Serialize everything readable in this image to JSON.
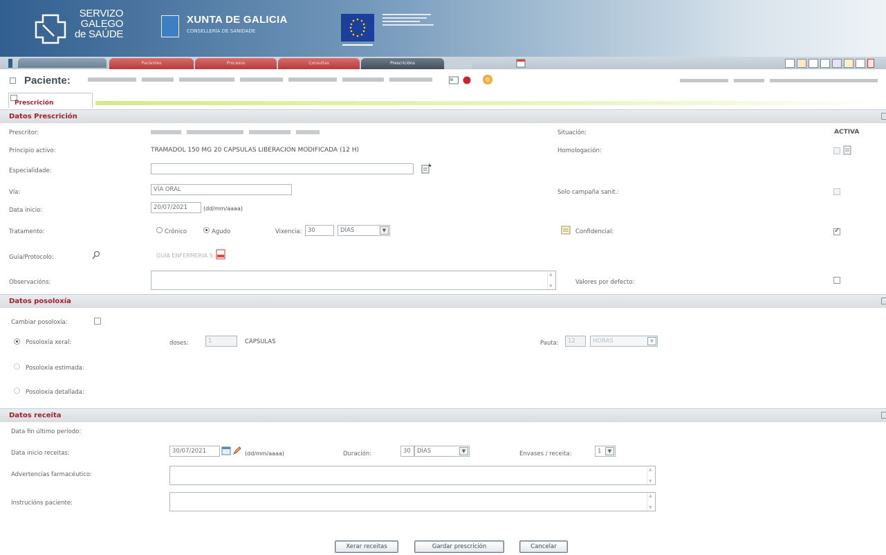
{
  "header": {
    "sgs_line1": "SERVIZO",
    "sgs_line2": "GALEGO",
    "sgs_line3": "de SAÚDE",
    "xunta_title": "XUNTA DE GALICIA",
    "xunta_sub": "CONSELLERÍA DE SANIDADE"
  },
  "tabs": [
    {
      "label": "Pacientes"
    },
    {
      "label": "Procesos"
    },
    {
      "label": "Consultas"
    },
    {
      "label": "Prescricións"
    }
  ],
  "patient": {
    "label": "Paciente:"
  },
  "subtab": {
    "label": "Prescrición"
  },
  "sections": {
    "prescripcion": "Datos Prescrición",
    "posoloxia": "Datos posoloxía",
    "receita": "Datos receita"
  },
  "prescripcion": {
    "prescriptor_label": "Prescritor:",
    "situacion_label": "Situación:",
    "situacion_value": "ACTIVA",
    "principio_label": "Principio activo:",
    "principio_value": "TRAMADOL 150 MG 20 CAPSULAS LIBERACION MODIFICADA (12 H)",
    "homologacion_label": "Homologación:",
    "especialidade_label": "Especialidade:",
    "via_label": "Vía:",
    "via_value": "VÍA ORAL",
    "solo_label": "Solo campaña sanit.:",
    "data_inicio_label": "Data inicio:",
    "data_inicio_value": "20/07/2021",
    "date_format": "(dd/mm/aaaa)",
    "tratamento_label": "Tratamento:",
    "cronico_label": "Crónico",
    "agudo_label": "Agudo",
    "vixencia_label": "Vixencia:",
    "vixencia_value": "30",
    "vixencia_unit": "DÍAS",
    "confidencial_label": "Confidencial:",
    "guia_label": "Guía/Protocolo:",
    "guia_value": "GUIA ENFERMERIA 5",
    "observacions_label": "Observacións:",
    "valores_label": "Valores por defecto:"
  },
  "posoloxia": {
    "cambiar_label": "Cambiar posoloxía:",
    "xeral_label": "Posoloxía xeral:",
    "doses_label": "doses:",
    "doses_value": "1",
    "doses_unit": "CÁPSULAS",
    "pauta_label": "Pauta:",
    "pauta_value": "12",
    "pauta_unit": "HORAS",
    "estimada_label": "Posoloxía estimada:",
    "detallada_label": "Posoloxía detallada:"
  },
  "receita": {
    "data_fin_label": "Data fin último período:",
    "data_inicio_label": "Data inicio receitas:",
    "data_inicio_value": "30/07/2021",
    "date_format": "(dd/mm/aaaa)",
    "duracion_label": "Duración:",
    "duracion_value": "30",
    "duracion_unit": "DÍAS",
    "envases_label": "Envases / receita:",
    "envases_value": "1",
    "advertencias_label": "Advertencias farmacéutico:",
    "instrucions_label": "Instrucións paciente:"
  },
  "buttons": {
    "xerar": "Xerar receitas",
    "gardar": "Gardar prescrición",
    "cancelar": "Cancelar"
  },
  "colors": {
    "section_title": "#a5202b",
    "tab_red": "#c44a4a",
    "banner_blue": "#315f8f"
  }
}
